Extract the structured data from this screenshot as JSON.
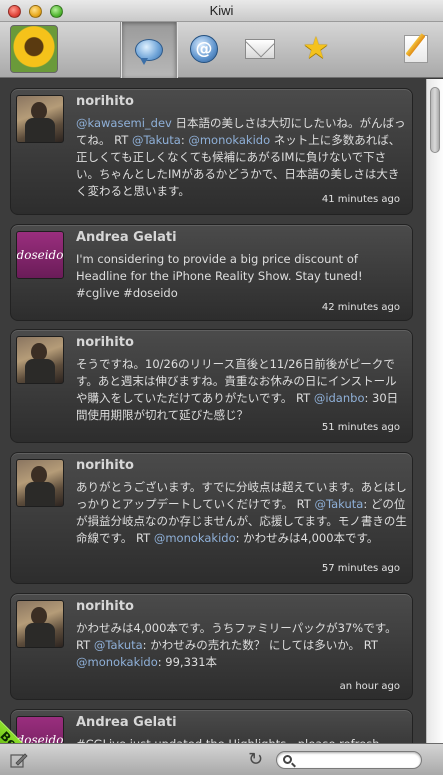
{
  "window": {
    "title": "Kiwi"
  },
  "toolbar": {
    "buttons": [
      {
        "name": "timeline",
        "icon": "speech-bubble-icon",
        "active": true
      },
      {
        "name": "mentions",
        "icon": "at-sign-icon",
        "label": "@"
      },
      {
        "name": "messages",
        "icon": "envelope-icon"
      },
      {
        "name": "favorites",
        "icon": "star-icon",
        "label": "★"
      },
      {
        "name": "compose",
        "icon": "compose-icon"
      }
    ]
  },
  "tweets": [
    {
      "user": "norihito",
      "avatar": "photo",
      "segments": [
        {
          "t": "@kawasemi_dev",
          "m": true
        },
        {
          "t": " 日本語の美しさは大切にしたいね。がんばってね。 RT "
        },
        {
          "t": "@Takuta",
          "m": true
        },
        {
          "t": ": "
        },
        {
          "t": "@monokakido",
          "m": true
        },
        {
          "t": " ネット上に多数あれば、正しくても正しくなくても候補にあがるIMに負けないで下さい。ちゃんとしたIMがあるかどうかで、日本語の美しさは大きく変わると思います。"
        }
      ],
      "time": "41 minutes ago"
    },
    {
      "user": "Andrea Gelati",
      "avatar": "doseido",
      "avatar_text": "doseido",
      "segments": [
        {
          "t": "I'm considering to provide a big price discount of Headline for the iPhone Reality Show. Stay tuned! #cglive #doseido"
        }
      ],
      "time": "42 minutes ago"
    },
    {
      "user": "norihito",
      "avatar": "photo",
      "segments": [
        {
          "t": "そうですね。10/26のリリース直後と11/26日前後がピークです。あと週末は伸びますね。貴重なお休みの日にインストールや購入をしていただけてありがたいです。 RT "
        },
        {
          "t": "@idanbo",
          "m": true
        },
        {
          "t": ": 30日間使用期限が切れて延びた感じ？"
        }
      ],
      "time": "51 minutes ago"
    },
    {
      "user": "norihito",
      "avatar": "photo",
      "segments": [
        {
          "t": "ありがとうございます。すでに分岐点は超えています。あとはしっかりとアップデートしていくだけです。 RT "
        },
        {
          "t": "@Takuta",
          "m": true
        },
        {
          "t": ": どの位が損益分岐点なのか存じませんが、応援してます。モノ書きの生命線です。 RT "
        },
        {
          "t": "@monokakido",
          "m": true
        },
        {
          "t": ": かわせみは4,000本です。"
        }
      ],
      "time": "57 minutes ago"
    },
    {
      "user": "norihito",
      "avatar": "photo",
      "segments": [
        {
          "t": "かわせみは4,000本です。うちファミリーパックが37%です。 RT "
        },
        {
          "t": "@Takuta",
          "m": true
        },
        {
          "t": ": かわせみの売れた数？ にしては多いか。 RT "
        },
        {
          "t": "@monokakido",
          "m": true
        },
        {
          "t": ": 99,331本"
        }
      ],
      "time": "an hour ago"
    },
    {
      "user": "Andrea Gelati",
      "avatar": "doseido",
      "avatar_text": "doseido",
      "segments": [
        {
          "t": "#CGLive just updated the Highlights - please refresh"
        }
      ],
      "time": ""
    }
  ],
  "beta": {
    "label": "Beta",
    "sub": "11 days left"
  },
  "bottom": {
    "search_placeholder": "",
    "search_value": ""
  }
}
